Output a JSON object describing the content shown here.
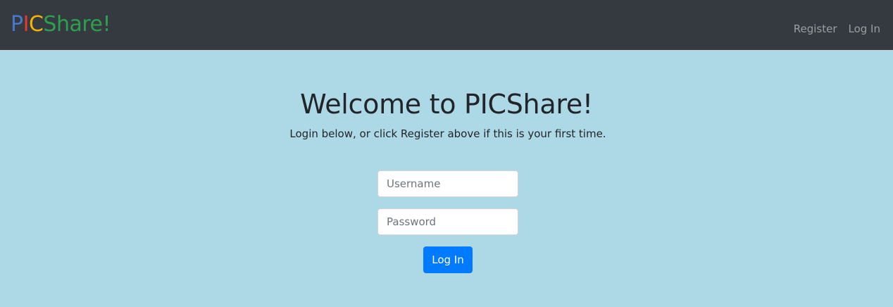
{
  "navbar": {
    "brand": {
      "letters": [
        {
          "text": "P",
          "color": "#4a77c9"
        },
        {
          "text": "I",
          "color": "#e03c31"
        },
        {
          "text": "C",
          "color": "#f5b400"
        },
        {
          "text": "Share!",
          "color": "#2e9e4f"
        }
      ]
    },
    "links": {
      "register": "Register",
      "login": "Log In"
    },
    "background": "#343a40"
  },
  "main": {
    "heading": "Welcome to PICShare!",
    "subtitle": "Login below, or click Register above if this is your first time.",
    "background": "#add8e6"
  },
  "form": {
    "username": {
      "value": "",
      "placeholder": "Username"
    },
    "password": {
      "value": "",
      "placeholder": "Password"
    },
    "submit_label": "Log In",
    "accent": "#007bff"
  }
}
